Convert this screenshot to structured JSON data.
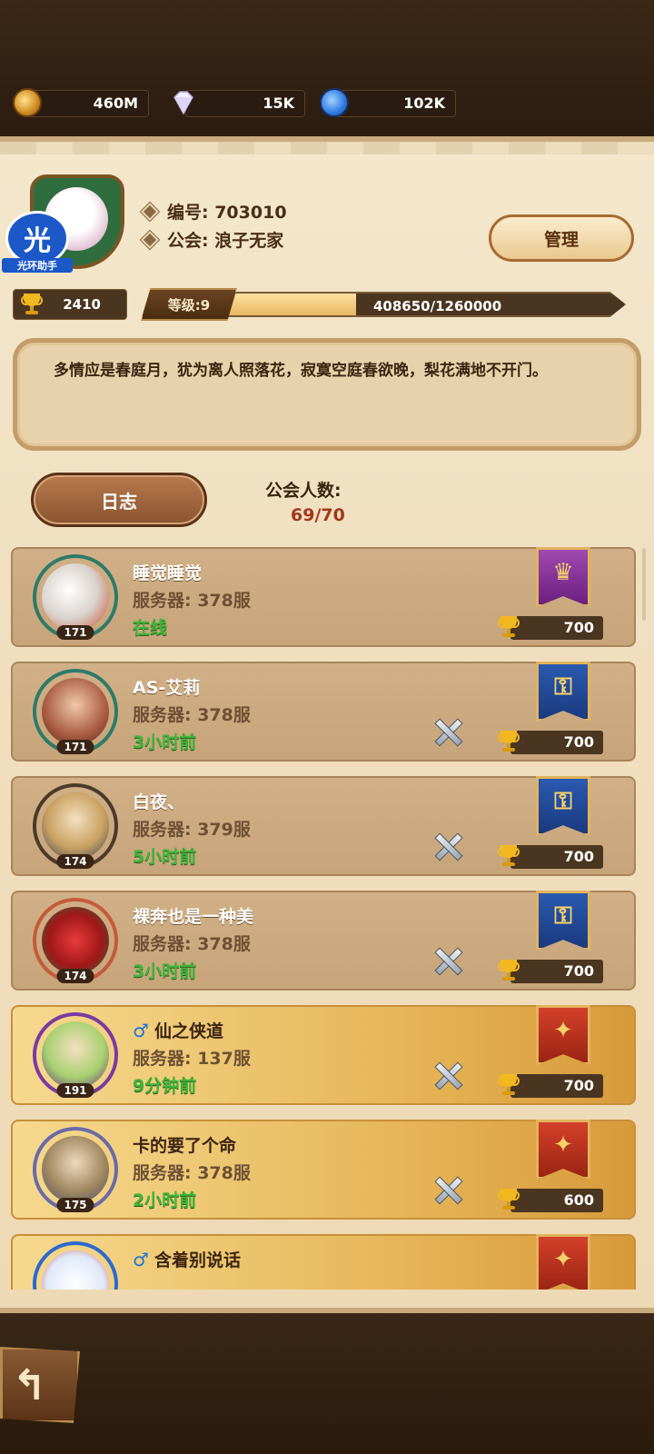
{
  "resources": [
    {
      "icon": "gold-coin-icon",
      "value": "460M"
    },
    {
      "icon": "diamond-icon",
      "value": "15K"
    },
    {
      "icon": "energy-icon",
      "value": "102K"
    }
  ],
  "guild": {
    "id_label": "编号: 703010",
    "name_label": "公会: 浪子无家",
    "manage_button": "管理",
    "trophies": "2410",
    "level_label": "等级:9",
    "exp_text": "408650/1260000",
    "exp_progress": 0.324,
    "notice": "多情应是春庭月，犹为离人照落花，寂寞空庭春欲晚，梨花满地不开门。",
    "log_button": "日志",
    "member_count_label": "公会人数:",
    "member_count": "69/70"
  },
  "watermark": {
    "glyph": "光",
    "caption": "光环助手"
  },
  "members": [
    {
      "name": "睡觉睡觉",
      "server": "服务器: 378服",
      "status": "在线",
      "level": "171",
      "score": "700",
      "banner": "purple",
      "male": false,
      "gold": false,
      "swords": false
    },
    {
      "name": "AS-艾莉",
      "server": "服务器: 378服",
      "status": "3小时前",
      "level": "171",
      "score": "700",
      "banner": "blue",
      "male": false,
      "gold": false,
      "swords": true
    },
    {
      "name": "白夜、",
      "server": "服务器: 379服",
      "status": "5小时前",
      "level": "174",
      "score": "700",
      "banner": "blue",
      "male": false,
      "gold": false,
      "swords": true
    },
    {
      "name": "裸奔也是一种美",
      "server": "服务器: 378服",
      "status": "3小时前",
      "level": "174",
      "score": "700",
      "banner": "blue",
      "male": false,
      "gold": false,
      "swords": true
    },
    {
      "name": "仙之侠道",
      "server": "服务器: 137服",
      "status": "9分钟前",
      "level": "191",
      "score": "700",
      "banner": "red",
      "male": true,
      "gold": true,
      "swords": true
    },
    {
      "name": "卡的要了个命",
      "server": "服务器: 378服",
      "status": "2小时前",
      "level": "175",
      "score": "600",
      "banner": "red",
      "male": false,
      "gold": true,
      "swords": true
    },
    {
      "name": "含着别说话",
      "server": "",
      "status": "",
      "level": "",
      "score": "",
      "banner": "red",
      "male": true,
      "gold": true,
      "swords": false
    }
  ],
  "colors": {
    "online": "#3fb43a",
    "member_count": "#a3381a",
    "parchment": "#f0dfc0"
  }
}
